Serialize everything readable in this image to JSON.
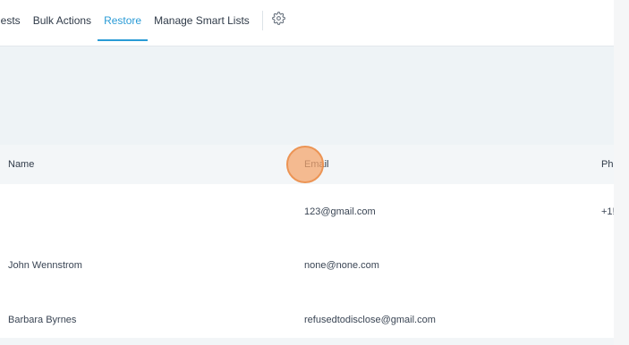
{
  "tabs": [
    {
      "label": "uests",
      "active": false
    },
    {
      "label": "Bulk Actions",
      "active": false
    },
    {
      "label": "Restore",
      "active": true
    },
    {
      "label": "Manage Smart Lists",
      "active": false
    }
  ],
  "settings_icon": "gear-icon",
  "colors": {
    "accent": "#2a9bd6",
    "highlight": "#f4a66e"
  },
  "table": {
    "headers": {
      "name": "Name",
      "email": "Email",
      "phone": "Ph"
    },
    "rows": [
      {
        "name": "",
        "email": "123@gmail.com",
        "phone": "+1!"
      },
      {
        "name": "John Wennstrom",
        "email": "none@none.com",
        "phone": ""
      },
      {
        "name": "Barbara Byrnes",
        "email": "refusedtodisclose@gmail.com",
        "phone": ""
      }
    ]
  }
}
